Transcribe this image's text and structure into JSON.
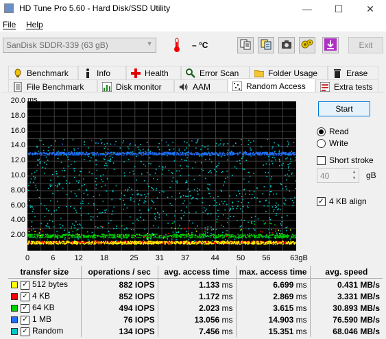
{
  "window": {
    "title": "HD Tune Pro 5.60 - Hard Disk/SSD Utility",
    "minimize": "—",
    "maximize": "☐",
    "close": "✕"
  },
  "menu": {
    "file": "File",
    "help": "Help"
  },
  "toolbar": {
    "drive": "SanDisk SDDR-339 (63 gB)",
    "temperature": "– °C",
    "exit": "Exit",
    "icons": [
      "copy-icon",
      "copy-all-icon",
      "camera-icon",
      "options-icon",
      "save-icon"
    ]
  },
  "tabs_row1": [
    {
      "label": "Benchmark",
      "icon": "benchmark-icon"
    },
    {
      "label": "Info",
      "icon": "info-icon"
    },
    {
      "label": "Health",
      "icon": "health-icon"
    },
    {
      "label": "Error Scan",
      "icon": "magnifier-icon"
    },
    {
      "label": "Folder Usage",
      "icon": "folder-icon"
    },
    {
      "label": "Erase",
      "icon": "trash-icon"
    }
  ],
  "tabs_row2": [
    {
      "label": "File Benchmark",
      "icon": "file-benchmark-icon"
    },
    {
      "label": "Disk monitor",
      "icon": "disk-monitor-icon"
    },
    {
      "label": "AAM",
      "icon": "speaker-icon"
    },
    {
      "label": "Random Access",
      "icon": "random-access-icon",
      "active": true
    },
    {
      "label": "Extra tests",
      "icon": "extra-tests-icon"
    }
  ],
  "controls": {
    "start": "Start",
    "read": "Read",
    "write": "Write",
    "mode": "read",
    "short_stroke": "Short stroke",
    "short_stroke_checked": false,
    "stroke_value": "40",
    "stroke_unit": "gB",
    "align_4kb": "4 KB align",
    "align_4kb_checked": true
  },
  "chart_data": {
    "type": "scatter",
    "ylabel": "ms",
    "ylim": [
      0,
      20
    ],
    "y_ticks": [
      "20.0",
      "18.0",
      "16.0",
      "14.0",
      "12.0",
      "10.0",
      "8.00",
      "6.00",
      "4.00",
      "2.00"
    ],
    "x_ticks": [
      "0",
      "6",
      "12",
      "18",
      "25",
      "31",
      "37",
      "44",
      "50",
      "56",
      "63gB"
    ],
    "xlim": [
      0,
      63
    ],
    "grid": true,
    "series": [
      {
        "name": "512 bytes",
        "color": "#ffff00",
        "typical_ms": 1.133,
        "spread_ms": 0.2
      },
      {
        "name": "4 KB",
        "color": "#ff0000",
        "typical_ms": 1.172,
        "spread_ms": 0.15
      },
      {
        "name": "64 KB",
        "color": "#00d000",
        "typical_ms": 2.023,
        "spread_ms": 0.25
      },
      {
        "name": "1 MB",
        "color": "#2070ff",
        "typical_ms": 13.056,
        "spread_ms": 0.2
      },
      {
        "name": "Random",
        "color": "#00c8c8",
        "typical_ms": 7.456,
        "spread_ms": 6.0
      }
    ]
  },
  "results": {
    "headers": [
      "transfer size",
      "operations / sec",
      "avg. access time",
      "max. access time",
      "avg. speed"
    ],
    "rows": [
      {
        "name": "512 bytes",
        "color": "#ffff00",
        "ops": "882",
        "ops_unit": "IOPS",
        "avg": "1.133",
        "avg_unit": "ms",
        "max": "6.699",
        "max_unit": "ms",
        "speed": "0.431",
        "speed_unit": "MB/s"
      },
      {
        "name": "4 KB",
        "color": "#ff0000",
        "ops": "852",
        "ops_unit": "IOPS",
        "avg": "1.172",
        "avg_unit": "ms",
        "max": "2.869",
        "max_unit": "ms",
        "speed": "3.331",
        "speed_unit": "MB/s"
      },
      {
        "name": "64 KB",
        "color": "#00d000",
        "ops": "494",
        "ops_unit": "IOPS",
        "avg": "2.023",
        "avg_unit": "ms",
        "max": "3.615",
        "max_unit": "ms",
        "speed": "30.893",
        "speed_unit": "MB/s"
      },
      {
        "name": "1 MB",
        "color": "#2070ff",
        "ops": "76",
        "ops_unit": "IOPS",
        "avg": "13.056",
        "avg_unit": "ms",
        "max": "14.903",
        "max_unit": "ms",
        "speed": "76.590",
        "speed_unit": "MB/s"
      },
      {
        "name": "Random",
        "color": "#00c8c8",
        "ops": "134",
        "ops_unit": "IOPS",
        "avg": "7.456",
        "avg_unit": "ms",
        "max": "15.351",
        "max_unit": "ms",
        "speed": "68.046",
        "speed_unit": "MB/s"
      }
    ]
  }
}
